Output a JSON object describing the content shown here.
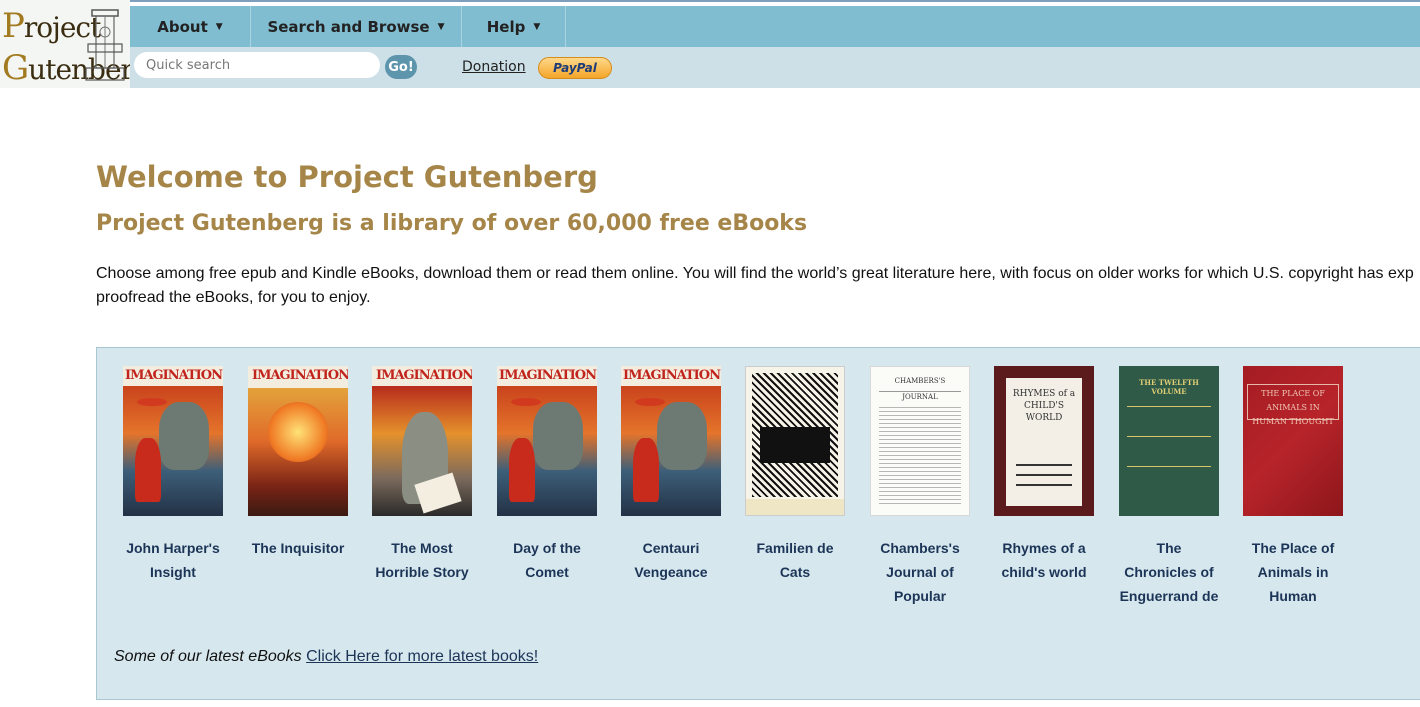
{
  "logo": {
    "line1": "Project",
    "line2": "Gutenberg"
  },
  "nav": {
    "about": "About",
    "search_browse": "Search and Browse",
    "help": "Help"
  },
  "search": {
    "placeholder": "Quick search",
    "go_label": "Go!"
  },
  "donation": {
    "label": "Donation",
    "paypal_label": "PayPal"
  },
  "main": {
    "title": "Welcome to Project Gutenberg",
    "subtitle": "Project Gutenberg is a library of over 60,000 free eBooks",
    "intro_line1": "Choose among free epub and Kindle eBooks, download them or read them online. You will find the world’s great literature here, with focus on older works for which U.S. copyright has exp",
    "intro_line2": "proofread the eBooks, for you to enjoy."
  },
  "books": [
    {
      "title_line1": "John Harper's",
      "title_line2": "Insight",
      "title_line3": "",
      "cover": "IMAGINATION"
    },
    {
      "title_line1": "The Inquisitor",
      "title_line2": "",
      "title_line3": "",
      "cover": "IMAGINATION"
    },
    {
      "title_line1": "The Most",
      "title_line2": "Horrible Story",
      "title_line3": "",
      "cover": "IMAGINATION"
    },
    {
      "title_line1": "Day of the",
      "title_line2": "Comet",
      "title_line3": "",
      "cover": "IMAGINATION"
    },
    {
      "title_line1": "Centauri",
      "title_line2": "Vengeance",
      "title_line3": "",
      "cover": "IMAGINATION"
    },
    {
      "title_line1": "Familien de",
      "title_line2": "Cats",
      "title_line3": "",
      "cover": ""
    },
    {
      "title_line1": "Chambers's",
      "title_line2": "Journal of",
      "title_line3": "Popular",
      "cover": "CHAMBERS'S JOURNAL"
    },
    {
      "title_line1": "Rhymes of a",
      "title_line2": "child's world",
      "title_line3": "",
      "cover": "RHYMES of a CHILD'S WORLD"
    },
    {
      "title_line1": "The",
      "title_line2": "Chronicles of",
      "title_line3": "Enguerrand de",
      "cover": "THE TWELFTH VOLUME"
    },
    {
      "title_line1": "The Place of",
      "title_line2": "Animals in",
      "title_line3": "Human",
      "cover": "THE PLACE OF ANIMALS IN HUMAN THOUGHT"
    }
  ],
  "latest": {
    "prefix": "Some of our latest eBooks",
    "link": "Click Here for more latest books!"
  },
  "colors": {
    "nav_bar": "#80bdd1",
    "search_bar": "#cde0e8",
    "heading": "#a68548",
    "panel": "#d6e7ee",
    "book_title": "#1c3557"
  }
}
